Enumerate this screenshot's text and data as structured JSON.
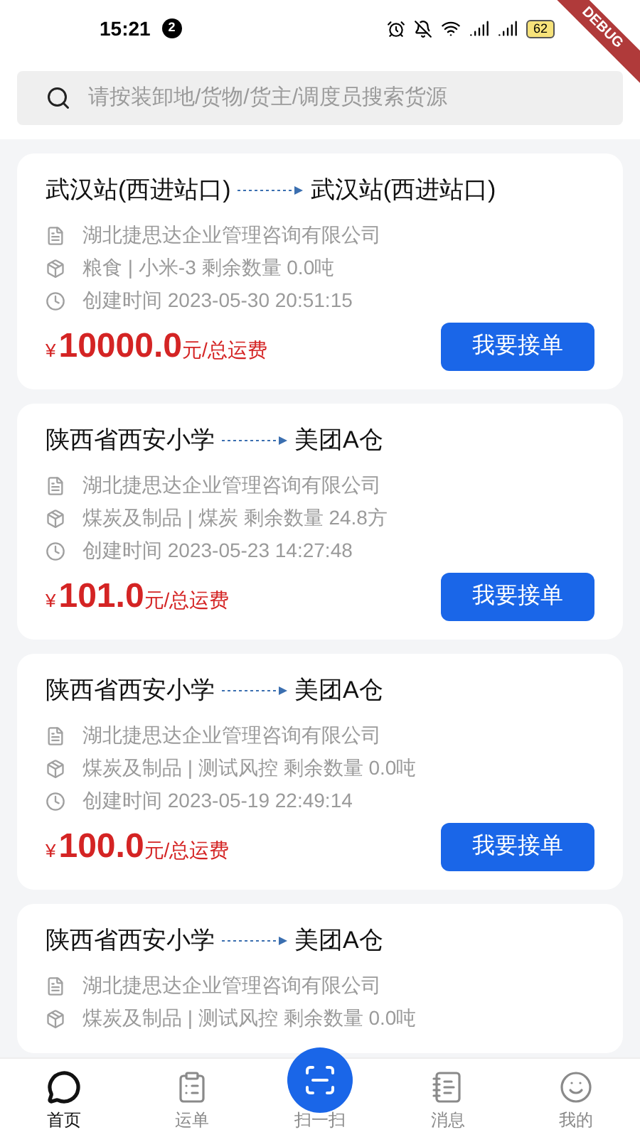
{
  "status_bar": {
    "time": "15:21",
    "notification_count": "2",
    "battery": "62"
  },
  "debug_banner": "DEBUG",
  "search": {
    "placeholder": "请按装卸地/货物/货主/调度员搜索货源"
  },
  "orders": [
    {
      "from": "武汉站(西进站口)",
      "to": "武汉站(西进站口)",
      "company": "湖北捷思达企业管理咨询有限公司",
      "cargo": "粮食 | 小米-3  剩余数量 0.0吨",
      "created": "创建时间 2023-05-30 20:51:15",
      "currency": "¥",
      "price": "10000.0",
      "unit": "元/总运费",
      "action": "我要接单"
    },
    {
      "from": "陕西省西安小学",
      "to": "美团A仓",
      "company": "湖北捷思达企业管理咨询有限公司",
      "cargo": "煤炭及制品 | 煤炭  剩余数量 24.8方",
      "created": "创建时间 2023-05-23 14:27:48",
      "currency": "¥",
      "price": "101.0",
      "unit": "元/总运费",
      "action": "我要接单"
    },
    {
      "from": "陕西省西安小学",
      "to": "美团A仓",
      "company": "湖北捷思达企业管理咨询有限公司",
      "cargo": "煤炭及制品 | 测试风控  剩余数量 0.0吨",
      "created": "创建时间 2023-05-19 22:49:14",
      "currency": "¥",
      "price": "100.0",
      "unit": "元/总运费",
      "action": "我要接单"
    },
    {
      "from": "陕西省西安小学",
      "to": "美团A仓",
      "company": "湖北捷思达企业管理咨询有限公司",
      "cargo": "煤炭及制品 | 测试风控  剩余数量 0.0吨"
    }
  ],
  "nav": [
    {
      "kind": "home",
      "label": "首页",
      "selected": true
    },
    {
      "kind": "orders",
      "label": "运单",
      "selected": false
    },
    {
      "kind": "scan",
      "label": "扫一扫",
      "selected": false
    },
    {
      "kind": "messages",
      "label": "消息",
      "selected": false
    },
    {
      "kind": "profile",
      "label": "我的",
      "selected": false
    }
  ]
}
